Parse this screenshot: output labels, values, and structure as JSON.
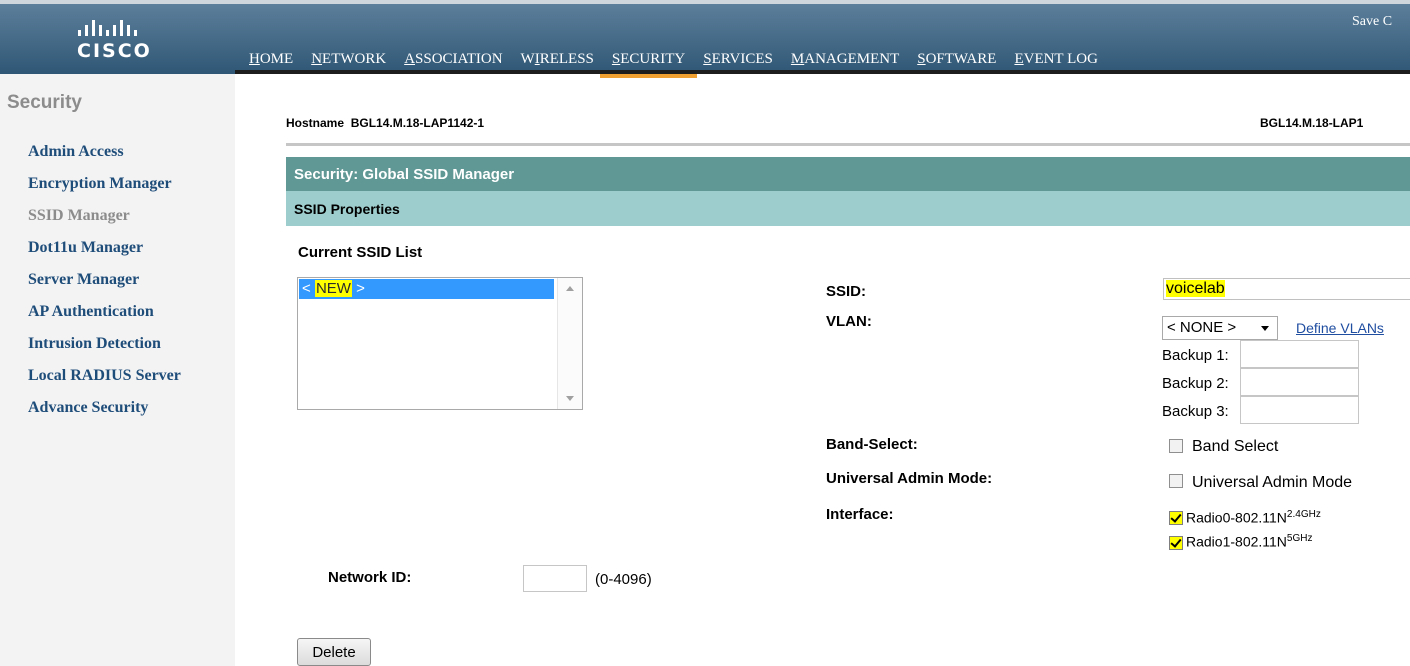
{
  "header": {
    "brand": "CISCO",
    "save_label": "Save C",
    "nav": [
      {
        "label": "HOME",
        "underline": "H",
        "rest": "OME"
      },
      {
        "label": "NETWORK",
        "underline": "N",
        "rest": "ETWORK"
      },
      {
        "label": "ASSOCIATION",
        "underline": "A",
        "rest": "SSOCIATION"
      },
      {
        "label": "WIRELESS",
        "pre": "W",
        "underline": "I",
        "rest": "RELESS"
      },
      {
        "label": "SECURITY",
        "underline": "S",
        "rest": "ECURITY"
      },
      {
        "label": "SERVICES",
        "underline": "S",
        "rest": "ERVICES"
      },
      {
        "label": "MANAGEMENT",
        "underline": "M",
        "rest": "ANAGEMENT"
      },
      {
        "label": "SOFTWARE",
        "underline": "S",
        "rest": "OFTWARE"
      },
      {
        "label": "EVENT LOG",
        "underline": "E",
        "rest": "VENT LOG"
      }
    ],
    "active_nav": "SECURITY"
  },
  "sidebar": {
    "title": "Security",
    "items": [
      {
        "label": "Admin Access"
      },
      {
        "label": "Encryption Manager"
      },
      {
        "label": "SSID Manager"
      },
      {
        "label": "Dot11u Manager"
      },
      {
        "label": "Server Manager"
      },
      {
        "label": "AP Authentication"
      },
      {
        "label": "Intrusion Detection"
      },
      {
        "label": "Local RADIUS Server"
      },
      {
        "label": "Advance Security"
      }
    ],
    "current": "SSID Manager"
  },
  "page": {
    "hostname_label": "Hostname",
    "hostname": "BGL14.M.18-LAP1142-1",
    "hostname_right": "BGL14.M.18-LAP1",
    "section_title": "Security: Global SSID Manager",
    "subsection_title": "SSID Properties",
    "current_ssid_list_title": "Current SSID List",
    "ssid_list": {
      "options": [
        {
          "pre": "< ",
          "highlight": "NEW",
          "post": " >"
        }
      ]
    },
    "ssid": {
      "label": "SSID:",
      "value": "voicelab"
    },
    "vlan": {
      "label": "VLAN:",
      "selected": "< NONE >",
      "define_link": "Define VLANs"
    },
    "backups": [
      {
        "label": "Backup 1:",
        "value": ""
      },
      {
        "label": "Backup 2:",
        "value": ""
      },
      {
        "label": "Backup 3:",
        "value": ""
      }
    ],
    "band_select": {
      "label": "Band-Select:",
      "checkbox_label": "Band Select",
      "checked": false
    },
    "universal_admin": {
      "label": "Universal Admin Mode:",
      "checkbox_label": "Universal Admin Mode",
      "checked": false
    },
    "interface": {
      "label": "Interface:",
      "radios": [
        {
          "label": "Radio0-802.11N",
          "sup": "2.4GHz",
          "checked": true
        },
        {
          "label": "Radio1-802.11N",
          "sup": "5GHz",
          "checked": true
        }
      ]
    },
    "network_id": {
      "label": "Network ID:",
      "value": "",
      "range": "(0-4096)"
    },
    "delete_label": "Delete"
  },
  "colors": {
    "header_top": "#5c7f9b",
    "header_bottom": "#2f5775",
    "active_tab_underline": "#f0a030",
    "section_bar": "#5f9895",
    "subsection_bar": "#9dcdcc",
    "sidebar_link": "#1f4d7a",
    "highlight": "#ffff00",
    "list_selection": "#3399ff"
  }
}
